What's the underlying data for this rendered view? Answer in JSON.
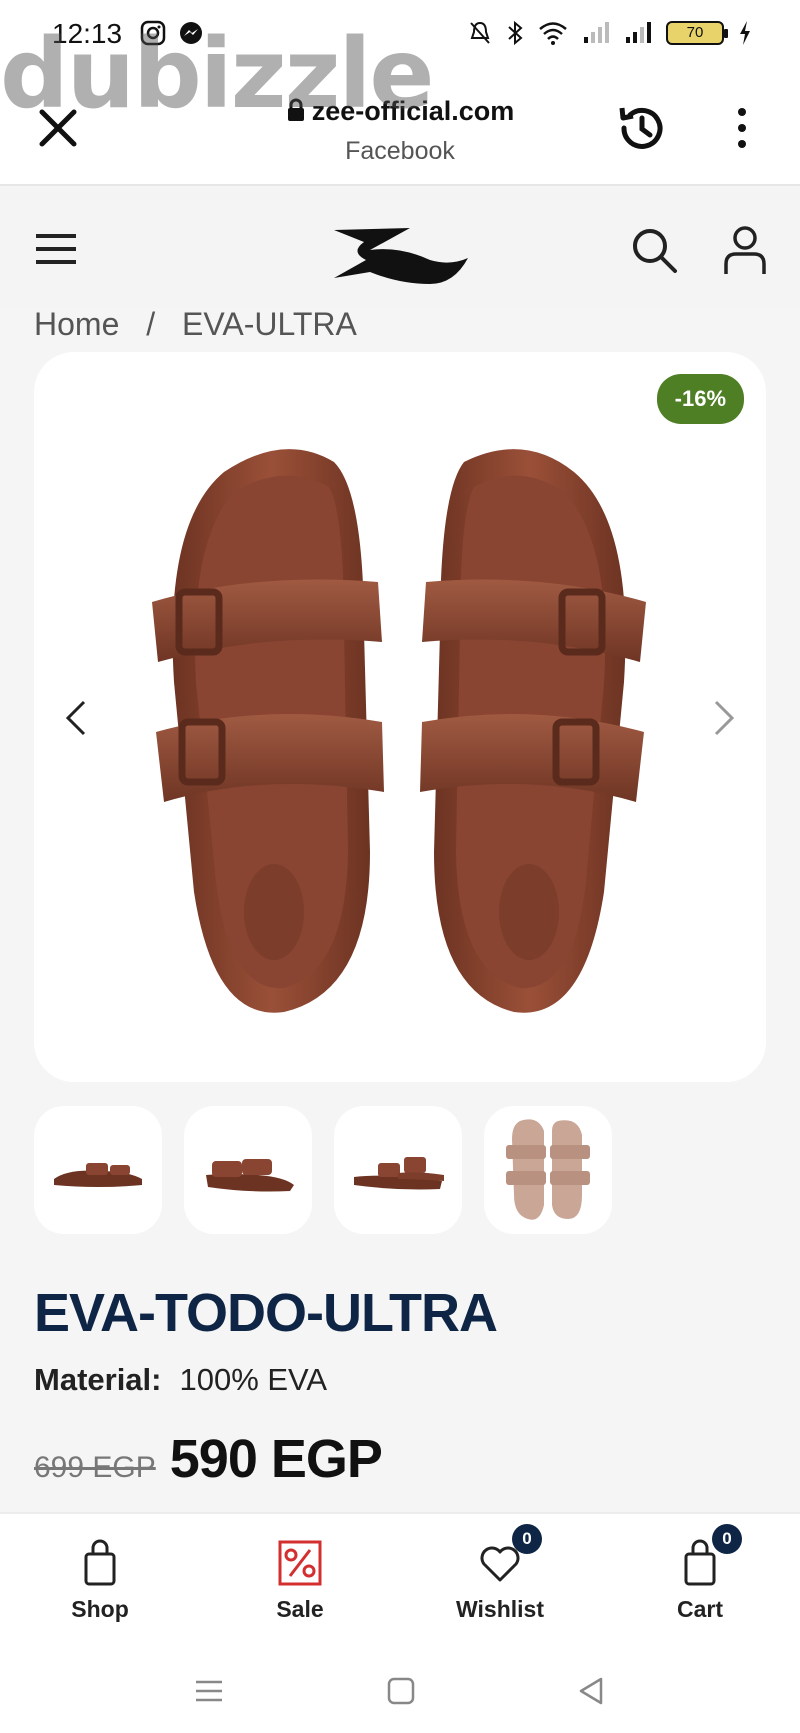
{
  "status_bar": {
    "time": "12:13",
    "battery": "70"
  },
  "watermark": "dubizzle",
  "browser": {
    "url": "zee-official.com",
    "subtitle": "Facebook"
  },
  "breadcrumb": {
    "items": [
      "Home",
      "/",
      "EVA-ULTRA"
    ]
  },
  "product": {
    "discount_badge": "-16%",
    "title": "EVA-TODO-ULTRA",
    "material_label": "Material:",
    "material_value": "100% EVA",
    "old_price": "699 EGP",
    "new_price": "590 EGP",
    "color": "#8a4532"
  },
  "bottom_nav": {
    "items": [
      {
        "label": "Shop",
        "icon": "shopping-bag-icon"
      },
      {
        "label": "Sale",
        "icon": "percent-tag-icon"
      },
      {
        "label": "Wishlist",
        "icon": "heart-icon",
        "badge": "0"
      },
      {
        "label": "Cart",
        "icon": "cart-bag-icon",
        "badge": "0"
      }
    ]
  },
  "colors": {
    "brand_navy": "#0e2545",
    "discount_green": "#4f7f25",
    "sale_red": "#d32f2f"
  }
}
